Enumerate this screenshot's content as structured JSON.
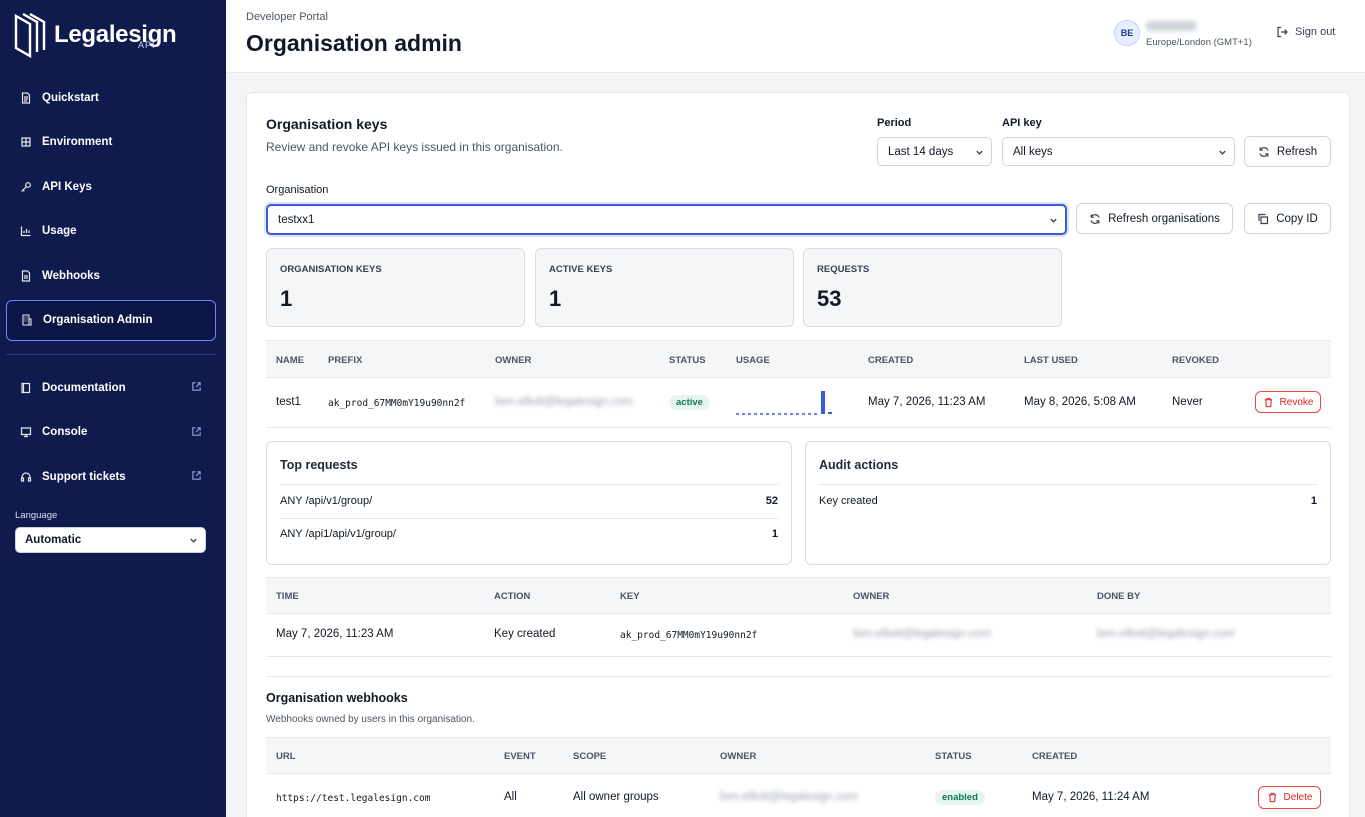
{
  "sidebar": {
    "logo_text": "Legalesign",
    "logo_sub": "API",
    "nav": [
      {
        "label": "Quickstart",
        "icon": "document-icon"
      },
      {
        "label": "Environment",
        "icon": "globe-icon"
      },
      {
        "label": "API Keys",
        "icon": "key-icon"
      },
      {
        "label": "Usage",
        "icon": "bar-chart-icon"
      },
      {
        "label": "Webhooks",
        "icon": "webhook-icon"
      },
      {
        "label": "Organisation Admin",
        "icon": "building-icon",
        "active": true
      }
    ],
    "nav2": [
      {
        "label": "Documentation",
        "icon": "book-icon"
      },
      {
        "label": "Console",
        "icon": "monitor-icon"
      },
      {
        "label": "Support tickets",
        "icon": "headset-icon"
      }
    ],
    "language_label": "Language",
    "language_value": "Automatic"
  },
  "header": {
    "breadcrumb": "Developer Portal",
    "title": "Organisation admin",
    "avatar_initials": "BE",
    "timezone": "Europe/London (GMT+1)",
    "sign_out": "Sign out"
  },
  "keys_section": {
    "title": "Organisation keys",
    "subtitle": "Review and revoke API keys issued in this organisation.",
    "period_label": "Period",
    "period_value": "Last 14 days",
    "apikey_label": "API key",
    "apikey_value": "All keys",
    "refresh": "Refresh",
    "org_label": "Organisation",
    "org_value": "testxx1",
    "refresh_orgs": "Refresh organisations",
    "copy_id": "Copy ID",
    "stats": [
      {
        "label": "ORGANISATION KEYS",
        "value": "1"
      },
      {
        "label": "ACTIVE KEYS",
        "value": "1"
      },
      {
        "label": "REQUESTS",
        "value": "53"
      }
    ],
    "columns": [
      "NAME",
      "PREFIX",
      "OWNER",
      "STATUS",
      "USAGE",
      "CREATED",
      "LAST USED",
      "REVOKED"
    ],
    "row": {
      "name": "test1",
      "prefix": "ak_prod_67MM0mY19u90nn2f",
      "owner": "ben.elliott@legalesign.com",
      "status": "active",
      "created": "May 7, 2026, 11:23 AM",
      "last_used": "May 8, 2026, 5:08 AM",
      "revoked": "Never",
      "revoke_label": "Revoke"
    }
  },
  "top_requests": {
    "title": "Top requests",
    "items": [
      {
        "path": "ANY /api/v1/group/",
        "count": "52"
      },
      {
        "path": "ANY /api1/api/v1/group/",
        "count": "1"
      }
    ]
  },
  "audit_actions": {
    "title": "Audit actions",
    "items": [
      {
        "action": "Key created",
        "count": "1"
      }
    ]
  },
  "audit_log": {
    "columns": [
      "TIME",
      "ACTION",
      "KEY",
      "OWNER",
      "DONE BY"
    ],
    "rows": [
      {
        "time": "May 7, 2026, 11:23 AM",
        "action": "Key created",
        "key": "ak_prod_67MM0mY19u90nn2f",
        "owner": "ben.elliott@legalesign.com",
        "done_by": "ben.elliott@legalesign.com"
      }
    ]
  },
  "webhooks": {
    "title": "Organisation webhooks",
    "subtitle": "Webhooks owned by users in this organisation.",
    "columns": [
      "URL",
      "EVENT",
      "SCOPE",
      "OWNER",
      "STATUS",
      "CREATED"
    ],
    "row": {
      "url": "https://test.legalesign.com",
      "event": "All",
      "scope": "All owner groups",
      "owner": "ben.elliott@legalesign.com",
      "status": "enabled",
      "created": "May 7, 2026, 11:24 AM",
      "delete_label": "Delete"
    }
  },
  "colors": {
    "sidebar_bg": "#0f1b4d",
    "accent": "#3b5bdb",
    "danger": "#dc2626",
    "success": "#14784a"
  }
}
